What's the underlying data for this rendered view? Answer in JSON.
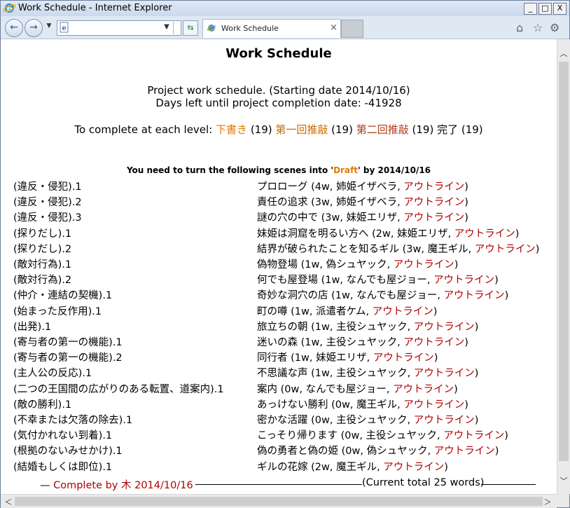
{
  "window": {
    "title": "Work Schedule - Internet Explorer",
    "min": "_",
    "max": "□",
    "close": "X"
  },
  "browser": {
    "address": "",
    "tab_title": "Work Schedule",
    "tab_close": "×"
  },
  "page": {
    "heading": "Work Schedule",
    "intro_line1": "Project work schedule. (Starting date 2014/10/16)",
    "intro_line2": "Days left until project completion date: -41928",
    "levels": {
      "prefix": "To complete at each level: ",
      "draft": "下書き",
      "draft_count": " (19) ",
      "first": "第一回推敲",
      "first_count": " (19) ",
      "second": "第二回推敲",
      "second_count": " (19) ",
      "done": "完了",
      "done_count": " (19)"
    },
    "scenes_heading": {
      "before": "You need to turn the following scenes into '",
      "draft": "Draft",
      "after": "' by 2014/10/16"
    },
    "link_label": "アウトライン",
    "rows": [
      {
        "left": "(違反・侵犯).1",
        "scene": "プロローグ (4w, 姉姫イザベラ, ",
        "end": ")"
      },
      {
        "left": "(違反・侵犯).2",
        "scene": "責任の追求 (3w, 姉姫イザベラ, ",
        "end": ")"
      },
      {
        "left": "(違反・侵犯).3",
        "scene": "謎の穴の中で (3w, 妹姫エリザ, ",
        "end": ")"
      },
      {
        "left": "(探りだし).1",
        "scene": "妹姫は洞窟を明るい方へ (2w, 妹姫エリザ, ",
        "end": ")"
      },
      {
        "left": "(探りだし).2",
        "scene": "結界が破られたことを知るギル (3w, 魔王ギル, ",
        "end": ")"
      },
      {
        "left": "(敵対行為).1",
        "scene": "偽物登場 (1w, 偽シュヤック, ",
        "end": ")"
      },
      {
        "left": "(敵対行為).2",
        "scene": "何でも屋登場 (1w, なんでも屋ジョー, ",
        "end": ")"
      },
      {
        "left": "(仲介・連結の契機).1",
        "scene": "奇妙な洞穴の店 (1w, なんでも屋ジョー, ",
        "end": ")"
      },
      {
        "left": "(始まった反作用).1",
        "scene": "町の噂 (1w, 派遣者ケム, ",
        "end": ")"
      },
      {
        "left": "(出発).1",
        "scene": "旅立ちの朝 (1w, 主役シュヤック, ",
        "end": ")"
      },
      {
        "left": "(寄与者の第一の機能).1",
        "scene": "迷いの森 (1w, 主役シュヤック, ",
        "end": ")"
      },
      {
        "left": "(寄与者の第一の機能).2",
        "scene": "同行者 (1w, 妹姫エリザ, ",
        "end": ")"
      },
      {
        "left": "(主人公の反応).1",
        "scene": "不思議な声 (1w, 主役シュヤック, ",
        "end": ")"
      },
      {
        "left": "(二つの王国間の広がりのある転置、道案内).1",
        "scene": "案内 (0w, なんでも屋ジョー, ",
        "end": ")"
      },
      {
        "left": "(敵の勝利).1",
        "scene": "あっけない勝利 (0w, 魔王ギル, ",
        "end": ")"
      },
      {
        "left": "(不幸または欠落の除去).1",
        "scene": "密かな活躍 (0w, 主役シュヤック, ",
        "end": ")"
      },
      {
        "left": "(気付かれない到着).1",
        "scene": "こっそり帰ります (0w, 主役シュヤック, ",
        "end": ")"
      },
      {
        "left": "(根拠のないみせかけ).1",
        "scene": "偽の勇者と偽の姫 (0w, 偽シュヤック, ",
        "end": ")"
      },
      {
        "left": "(結婚もしくは即位).1",
        "scene": "ギルの花嫁 (2w, 魔王ギル, ",
        "end": ")"
      }
    ],
    "footer": {
      "dash": "— ",
      "complete": "Complete by 木 2014/10/16",
      "total": "(Current total 25 words)"
    }
  },
  "colors": {
    "draft": "#e07a00",
    "link": "#b00000",
    "titlebar": "#dfe9f6"
  }
}
